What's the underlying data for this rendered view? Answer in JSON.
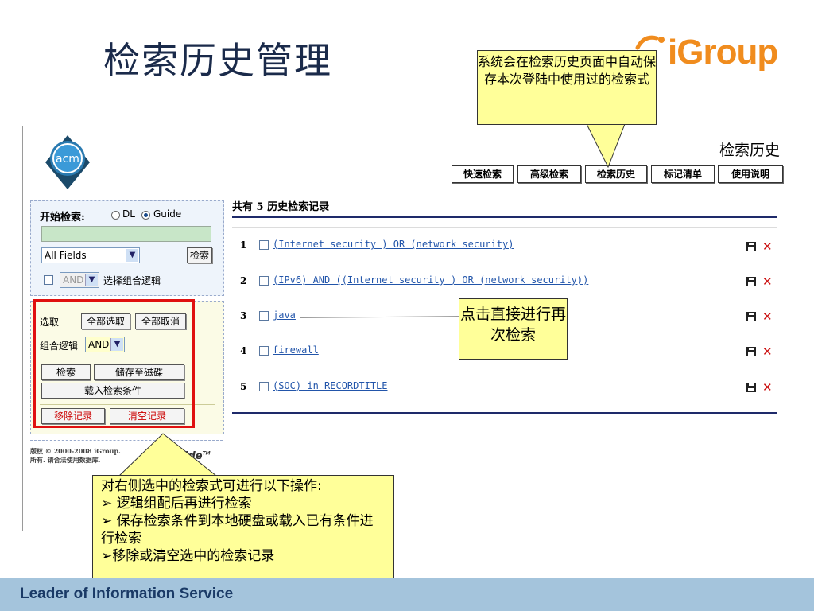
{
  "slide": {
    "title": "检索历史管理",
    "brand": "iGroup",
    "footer": "Leader of Information Service"
  },
  "callouts": {
    "top": "系统会在检索历史页面中自动保存本次登陆中使用过的检索式",
    "middle": "点击直接进行再次检索",
    "bottom": {
      "heading": "对右侧选中的检索式可进行以下操作:",
      "items": [
        "➢ 逻辑组配后再进行检索",
        "➢ 保存检索条件到本地硬盘或载入已有条件进行检索",
        "➢移除或清空选中的检索记录"
      ]
    }
  },
  "app": {
    "logo_text": "acm",
    "page_heading": "检索历史",
    "nav": [
      "快速检索",
      "高级检索",
      "检索历史",
      "标记清单",
      "使用说明"
    ],
    "search": {
      "label": "开始检索:",
      "option_dl": "DL",
      "option_guide": "Guide",
      "selected_option": "Guide",
      "input_value": "",
      "field_select": "All Fields",
      "search_button": "检索",
      "logic_select": "AND",
      "logic_label": "选择组合逻辑"
    },
    "actions": {
      "select_label": "选取",
      "select_all": "全部选取",
      "deselect_all": "全部取消",
      "combine_label": "组合逻辑",
      "combine_value": "AND",
      "search": "检索",
      "save_to_disk": "储存至磁碟",
      "load_conditions": "载入检索条件",
      "remove": "移除记录",
      "clear": "清空记录"
    },
    "copyright_line1": "版权 © 2000-2008 iGroup.",
    "copyright_line2": "所有. 请合法使用数据库.",
    "guide_logo": "ide",
    "history": {
      "summary": "共有 5 历史检索记录",
      "rows": [
        {
          "num": "1",
          "query": "(Internet security ) OR (network security)"
        },
        {
          "num": "2",
          "query": "(IPv6) AND ((Internet security ) OR (network security))"
        },
        {
          "num": "3",
          "query": "java"
        },
        {
          "num": "4",
          "query": "firewall"
        },
        {
          "num": "5",
          "query": "(SOC) in RECORDTITLE"
        }
      ]
    }
  },
  "colors": {
    "brand_orange": "#f08c1e",
    "callout_bg": "#ffff99",
    "highlight_red": "#e01010",
    "footer_bg": "#a4c4dc",
    "rule_navy": "#1e2a6a"
  }
}
